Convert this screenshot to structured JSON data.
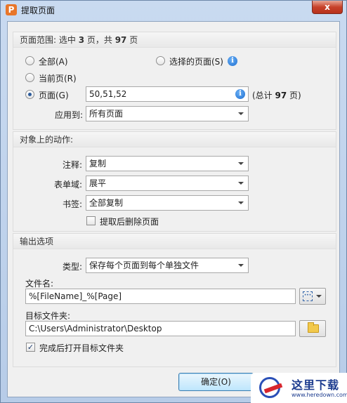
{
  "window": {
    "title": "提取页面",
    "app_icon": "P",
    "close_label": "x"
  },
  "page_range": {
    "header_prefix": "页面范围: 选中 ",
    "selected_count": "3",
    "header_mid": " 页，共 ",
    "total_count": "97",
    "header_suffix": " 页",
    "all_label": "全部(A)",
    "current_label": "当前页(R)",
    "selected_pages_label": "选择的页面(S)",
    "pages_label": "页面(G)",
    "pages_value": "50,51,52",
    "total_prefix": "(总计 ",
    "total_value": "97",
    "total_suffix": " 页)",
    "apply_label": "应用到:",
    "apply_value": "所有页面",
    "selected_option": "pages"
  },
  "actions": {
    "header": "对象上的动作:",
    "annotation_label": "注释:",
    "annotation_value": "复制",
    "form_label": "表单域:",
    "form_value": "展平",
    "bookmark_label": "书签:",
    "bookmark_value": "全部复制",
    "delete_after_label": "提取后删除页面",
    "delete_after_checked": false
  },
  "output": {
    "header": "输出选项",
    "type_label": "类型:",
    "type_value": "保存每个页面到每个单独文件",
    "filename_label": "文件名:",
    "filename_value": "%[FileName]_%[Page]",
    "folder_label": "目标文件夹:",
    "folder_value": "C:\\Users\\Administrator\\Desktop",
    "open_after_label": "完成后打开目标文件夹",
    "open_after_checked": true
  },
  "buttons": {
    "ok_label": "确定(O)"
  },
  "watermark": {
    "brand": "这里下载",
    "url": "www.heredown.com"
  },
  "icons": {
    "info": "info-icon",
    "macro": "insert-macro-icon",
    "folder": "folder-icon"
  }
}
